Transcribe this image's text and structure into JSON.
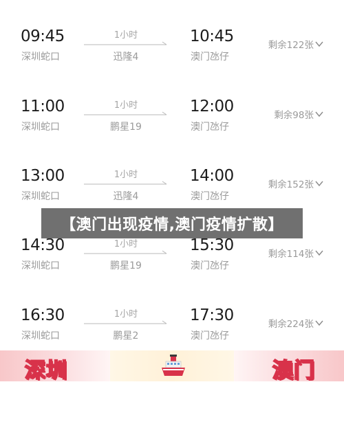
{
  "sailings": [
    {
      "dep_time": "09:45",
      "dep_port": "深圳蛇口",
      "duration": "1小时",
      "ship": "迅隆4",
      "arr_time": "10:45",
      "arr_port": "澳门氹仔",
      "remaining": "剩余122张"
    },
    {
      "dep_time": "11:00",
      "dep_port": "深圳蛇口",
      "duration": "1小时",
      "ship": "鹏星19",
      "arr_time": "12:00",
      "arr_port": "澳门氹仔",
      "remaining": "剩余98张"
    },
    {
      "dep_time": "13:00",
      "dep_port": "深圳蛇口",
      "duration": "1小时",
      "ship": "迅隆4",
      "arr_time": "14:00",
      "arr_port": "澳门氹仔",
      "remaining": "剩余152张"
    },
    {
      "dep_time": "14:30",
      "dep_port": "深圳蛇口",
      "duration": "1小时",
      "ship": "鹏星19",
      "arr_time": "15:30",
      "arr_port": "澳门氹仔",
      "remaining": "剩余114张"
    },
    {
      "dep_time": "16:30",
      "dep_port": "深圳蛇口",
      "duration": "1小时",
      "ship": "鹏星2",
      "arr_time": "17:30",
      "arr_port": "澳门氹仔",
      "remaining": "剩余224张"
    }
  ],
  "overlay_title": "【澳门出现疫情,澳门疫情扩散】",
  "bottom_banner": {
    "left_label": "深圳",
    "right_label": "澳门",
    "icon": "ferry-icon"
  },
  "colors": {
    "time_text": "#1c1c1c",
    "secondary_text": "#9a9a9a",
    "overlay_bg": "#646464",
    "banner_red": "#d8324a"
  }
}
